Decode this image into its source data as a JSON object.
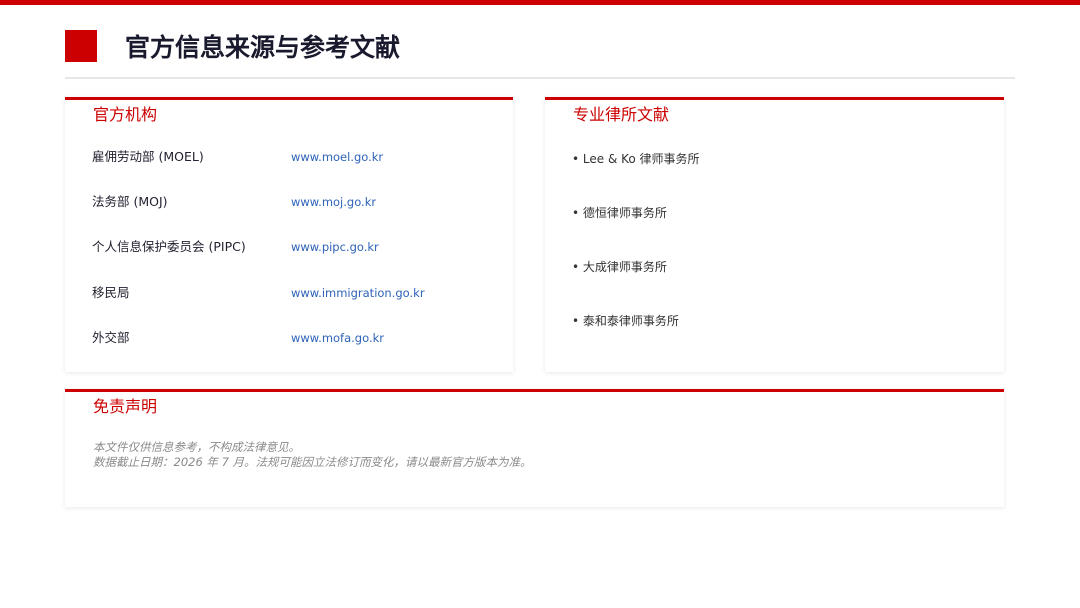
{
  "page": {
    "title": "官方信息来源与参考文献"
  },
  "official": {
    "title": "官方机构",
    "rows": [
      {
        "name": "雇佣劳动部 (MOEL)",
        "url": "www.moel.go.kr"
      },
      {
        "name": "法务部 (MOJ)",
        "url": "www.moj.go.kr"
      },
      {
        "name": "个人信息保护委员会 (PIPC)",
        "url": "www.pipc.go.kr"
      },
      {
        "name": "移民局",
        "url": "www.immigration.go.kr"
      },
      {
        "name": "外交部",
        "url": "www.mofa.go.kr"
      }
    ]
  },
  "lawfirms": {
    "title": "专业律所文献",
    "items": [
      "• Lee & Ko 律师事务所",
      "• 德恒律师事务所",
      "• 大成律师事务所",
      "• 泰和泰律师事务所"
    ]
  },
  "disclaimer": {
    "title": "免责声明",
    "lines": [
      "本文件仅供信息参考，不构成法律意见。",
      "数据截止日期：2026 年 7 月。法规可能因立法修订而变化，请以最新官方版本为准。"
    ]
  },
  "colors": {
    "accent": "#cc0000",
    "link": "#2e63b8",
    "title_text": "#1a1a2e",
    "muted": "#8a8a8a"
  }
}
